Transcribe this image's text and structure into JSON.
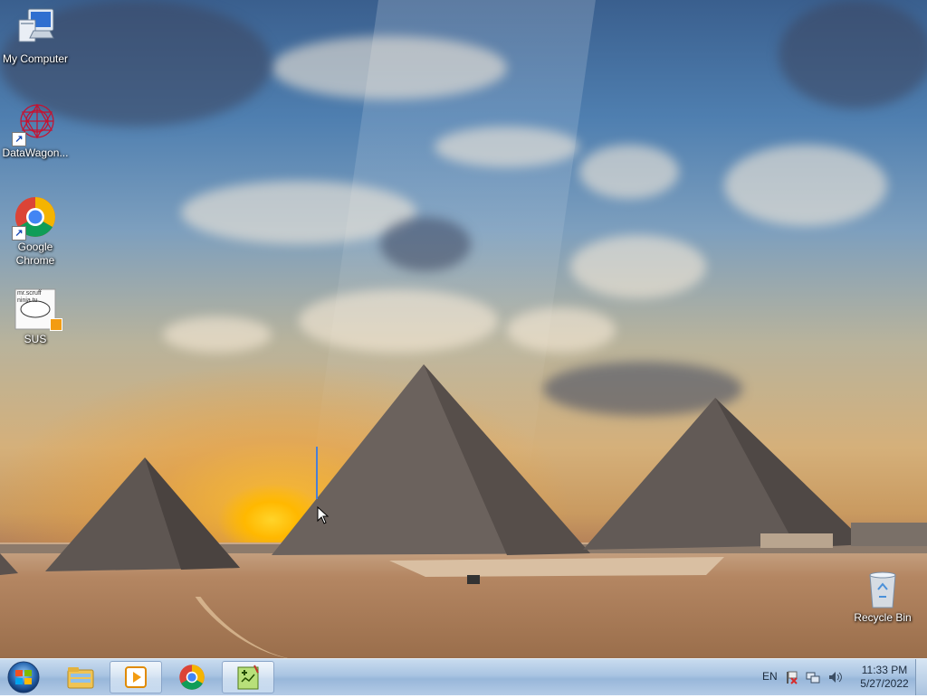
{
  "desktop": {
    "icons": [
      {
        "label": "My Computer",
        "icon": "computer-icon"
      },
      {
        "label": "DataWagon...",
        "icon": "datawagon-icon",
        "shortcut": true
      },
      {
        "label": "Google Chrome",
        "icon": "chrome-icon",
        "shortcut": true
      },
      {
        "label": "SUS",
        "icon": "sus-image-icon",
        "thumbnail_text": "mr.scruff ninja tu"
      },
      {
        "label": "Recycle Bin",
        "icon": "recycle-bin-icon"
      }
    ]
  },
  "taskbar": {
    "start": {
      "icon": "windows-start-icon"
    },
    "pinned": [
      {
        "name": "windows-explorer",
        "icon": "folder-icon",
        "active": false
      },
      {
        "name": "media-player",
        "icon": "media-player-icon",
        "active": true
      },
      {
        "name": "google-chrome",
        "icon": "chrome-icon",
        "active": false
      },
      {
        "name": "notepad-plus-plus",
        "icon": "notepad-icon",
        "active": true
      }
    ],
    "tray": {
      "language": "EN",
      "icons": [
        "action-center-flag-icon",
        "network-icon",
        "volume-icon"
      ],
      "time": "11:33 PM",
      "date": "5/27/2022"
    }
  },
  "colors": {
    "taskbar": "#a9c4e2",
    "chrome_red": "#db4437",
    "chrome_green": "#0f9d58",
    "chrome_yellow": "#f4b400",
    "chrome_blue": "#4285f4"
  }
}
